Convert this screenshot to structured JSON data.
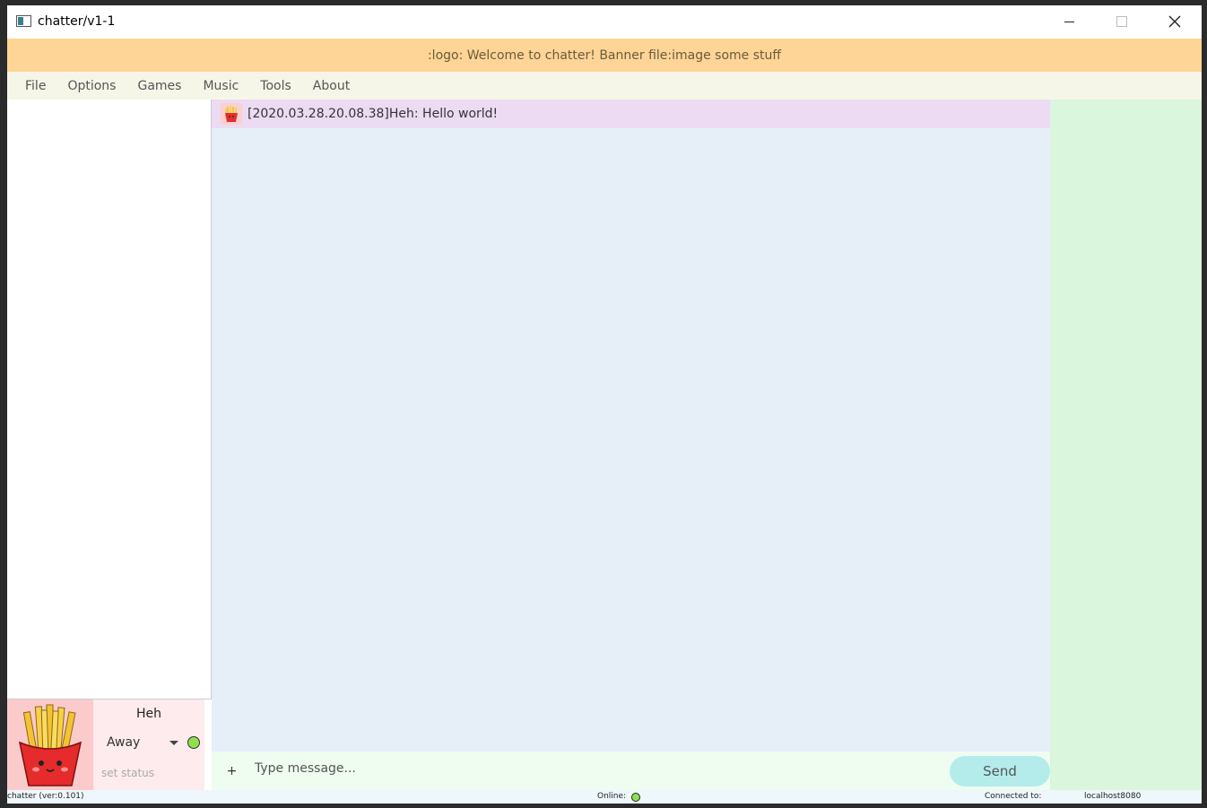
{
  "window": {
    "title": "chatter/v1-1"
  },
  "banner": {
    "text": ":logo: Welcome to chatter! Banner file:image some stuff"
  },
  "menu": {
    "items": [
      "File",
      "Options",
      "Games",
      "Music",
      "Tools",
      "About"
    ]
  },
  "chat": {
    "messages": [
      {
        "text": "[2020.03.28.20.08.38]Heh: Hello world!",
        "avatar": "fries-icon"
      }
    ]
  },
  "user": {
    "name": "Heh",
    "status": "Away",
    "status_color": "#8ee04e",
    "set_status_placeholder": "set status",
    "avatar": "fries-avatar"
  },
  "composer": {
    "add_label": "+",
    "placeholder": "Type message...",
    "send_label": "Send"
  },
  "statusbar": {
    "version": "chatter (ver:0.101)",
    "online_label": "Online:",
    "online_color": "#8ee04e",
    "connected_label": "Connected to:",
    "host": "localhost8080"
  },
  "colors": {
    "banner": "#fed596",
    "menubar": "#f6f6e8",
    "chat_bg": "#e6eef8",
    "message_bg": "#ecdbf3",
    "right_panel": "#daf6dc",
    "send_button": "#b4ecec"
  }
}
